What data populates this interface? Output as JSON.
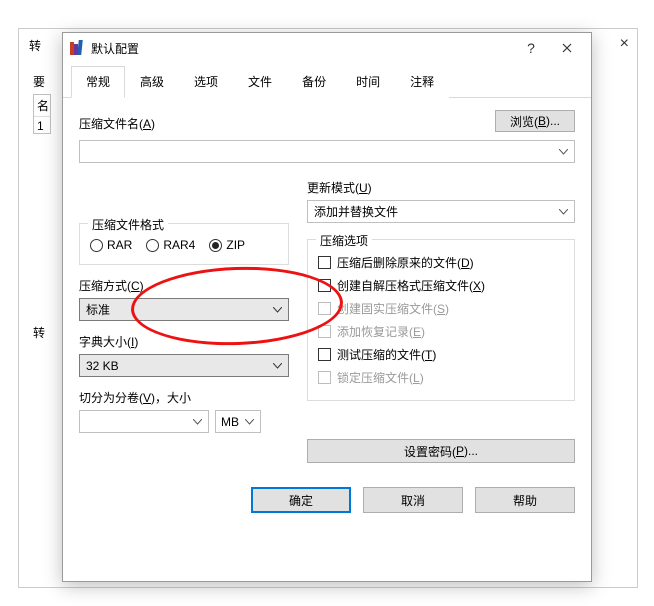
{
  "bg": {
    "title_fragment": "转",
    "close": "×",
    "label1": "要",
    "label2": "名",
    "cell": "1",
    "label3": "转"
  },
  "dialog": {
    "title": "默认配置",
    "help": "?",
    "tabs": [
      "常规",
      "高级",
      "选项",
      "文件",
      "备份",
      "时间",
      "注释"
    ],
    "active_tab": 0,
    "archive_name": {
      "label": "压缩文件名(",
      "key": "A",
      "suffix": ")"
    },
    "browse": {
      "label": "浏览(",
      "key": "B",
      "suffix": ")..."
    },
    "update_mode": {
      "label": "更新模式(",
      "key": "U",
      "suffix": ")",
      "value": "添加并替换文件"
    },
    "format_group": {
      "title": "压缩文件格式",
      "options": [
        "RAR",
        "RAR4",
        "ZIP"
      ],
      "selected": 2
    },
    "method": {
      "label": "压缩方式(",
      "key": "C",
      "suffix": ")",
      "value": "标准"
    },
    "dict": {
      "label": "字典大小(",
      "key": "I",
      "suffix": ")",
      "value": "32 KB"
    },
    "split": {
      "label": "切分为分卷(",
      "key": "V",
      "suffix": ")，大小",
      "unit": "MB"
    },
    "options_group": {
      "title": "压缩选项",
      "items": [
        {
          "text": "压缩后删除原来的文件(",
          "key": "D",
          "suffix": ")",
          "disabled": false
        },
        {
          "text": "创建自解压格式压缩文件(",
          "key": "X",
          "suffix": ")",
          "disabled": false
        },
        {
          "text": "创建固实压缩文件(",
          "key": "S",
          "suffix": ")",
          "disabled": true
        },
        {
          "text": "添加恢复记录(",
          "key": "E",
          "suffix": ")",
          "disabled": true
        },
        {
          "text": "测试压缩的文件(",
          "key": "T",
          "suffix": ")",
          "disabled": false
        },
        {
          "text": "锁定压缩文件(",
          "key": "L",
          "suffix": ")",
          "disabled": true
        }
      ]
    },
    "password": {
      "label": "设置密码(",
      "key": "P",
      "suffix": ")..."
    },
    "buttons": {
      "ok": "确定",
      "cancel": "取消",
      "help": "帮助"
    }
  }
}
